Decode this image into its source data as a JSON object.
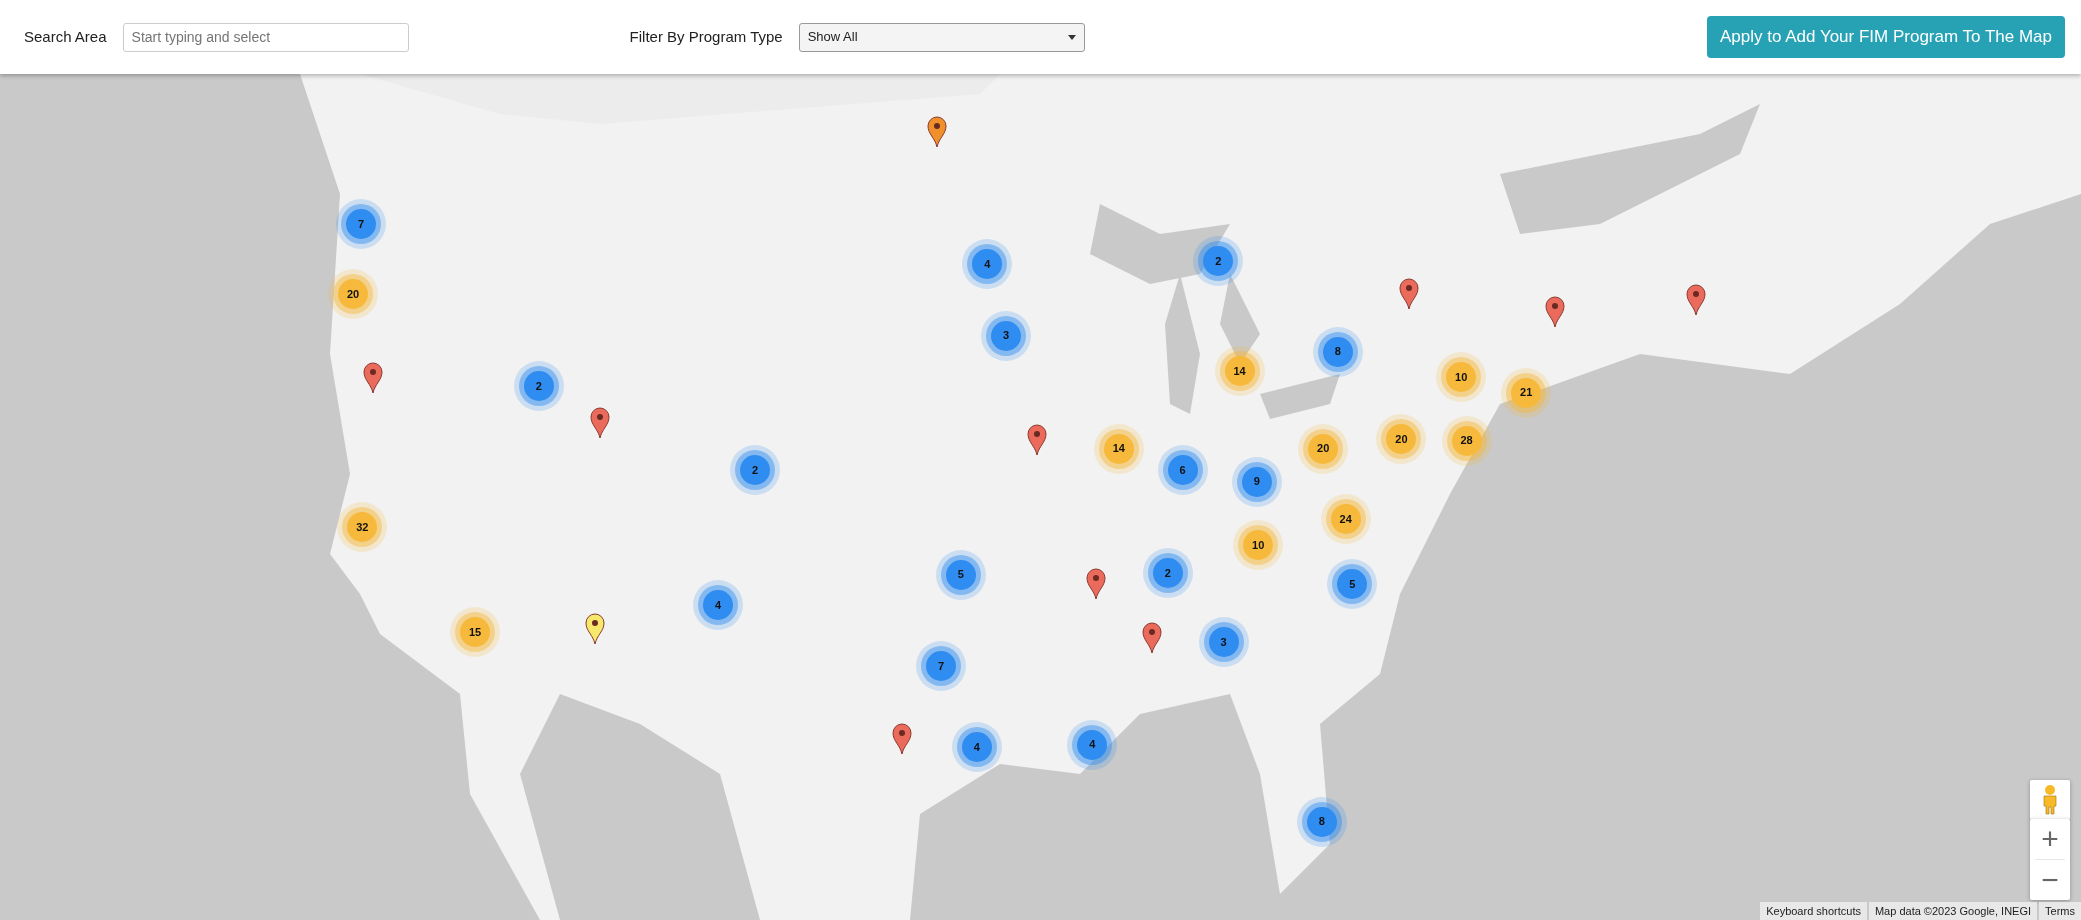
{
  "header": {
    "search_label": "Search Area",
    "search": {
      "placeholder": "Start typing and select"
    },
    "filter_label": "Filter By Program Type",
    "filter": {
      "value": "Show All"
    },
    "apply_button": "Apply to Add Your FIM Program To The Map"
  },
  "map": {
    "clusters": [
      {
        "count": "7",
        "color": "#2f8cf0"
      },
      {
        "count": "20",
        "color": "#f6b93b"
      },
      {
        "count": "2",
        "color": "#2f8cf0"
      },
      {
        "count": "4",
        "color": "#2f8cf0"
      },
      {
        "count": "3",
        "color": "#2f8cf0"
      },
      {
        "count": "2",
        "color": "#2f8cf0"
      },
      {
        "count": "8",
        "color": "#2f8cf0"
      },
      {
        "count": "14",
        "color": "#f6b93b"
      },
      {
        "count": "10",
        "color": "#f6b93b"
      },
      {
        "count": "21",
        "color": "#f6b93b"
      },
      {
        "count": "20",
        "color": "#f6b93b"
      },
      {
        "count": "28",
        "color": "#f6b93b"
      },
      {
        "count": "20",
        "color": "#f6b93b"
      },
      {
        "count": "14",
        "color": "#f6b93b"
      },
      {
        "count": "6",
        "color": "#2f8cf0"
      },
      {
        "count": "9",
        "color": "#2f8cf0"
      },
      {
        "count": "2",
        "color": "#2f8cf0"
      },
      {
        "count": "32",
        "color": "#f6b93b"
      },
      {
        "count": "24",
        "color": "#f6b93b"
      },
      {
        "count": "10",
        "color": "#f6b93b"
      },
      {
        "count": "5",
        "color": "#2f8cf0"
      },
      {
        "count": "2",
        "color": "#2f8cf0"
      },
      {
        "count": "5",
        "color": "#2f8cf0"
      },
      {
        "count": "4",
        "color": "#2f8cf0"
      },
      {
        "count": "15",
        "color": "#f6b93b"
      },
      {
        "count": "3",
        "color": "#2f8cf0"
      },
      {
        "count": "7",
        "color": "#2f8cf0"
      },
      {
        "count": "4",
        "color": "#2f8cf0"
      },
      {
        "count": "4",
        "color": "#2f8cf0"
      },
      {
        "count": "8",
        "color": "#2f8cf0"
      }
    ],
    "pins": [
      {
        "color": "#f0902a"
      },
      {
        "color": "#ea6a5c"
      },
      {
        "color": "#ea6a5c"
      },
      {
        "color": "#ea6a5c"
      },
      {
        "color": "#ea6a5c"
      },
      {
        "color": "#ea6a5c"
      },
      {
        "color": "#ea6a5c"
      },
      {
        "color": "#ea6a5c"
      },
      {
        "color": "#ea6a5c"
      },
      {
        "color": "#f5e86a"
      },
      {
        "color": "#ea6a5c"
      }
    ],
    "zoom_in": "+",
    "zoom_out": "−",
    "attribution": [
      "Keyboard shortcuts",
      "Map data ©2023 Google, INEGI",
      "Terms"
    ]
  }
}
